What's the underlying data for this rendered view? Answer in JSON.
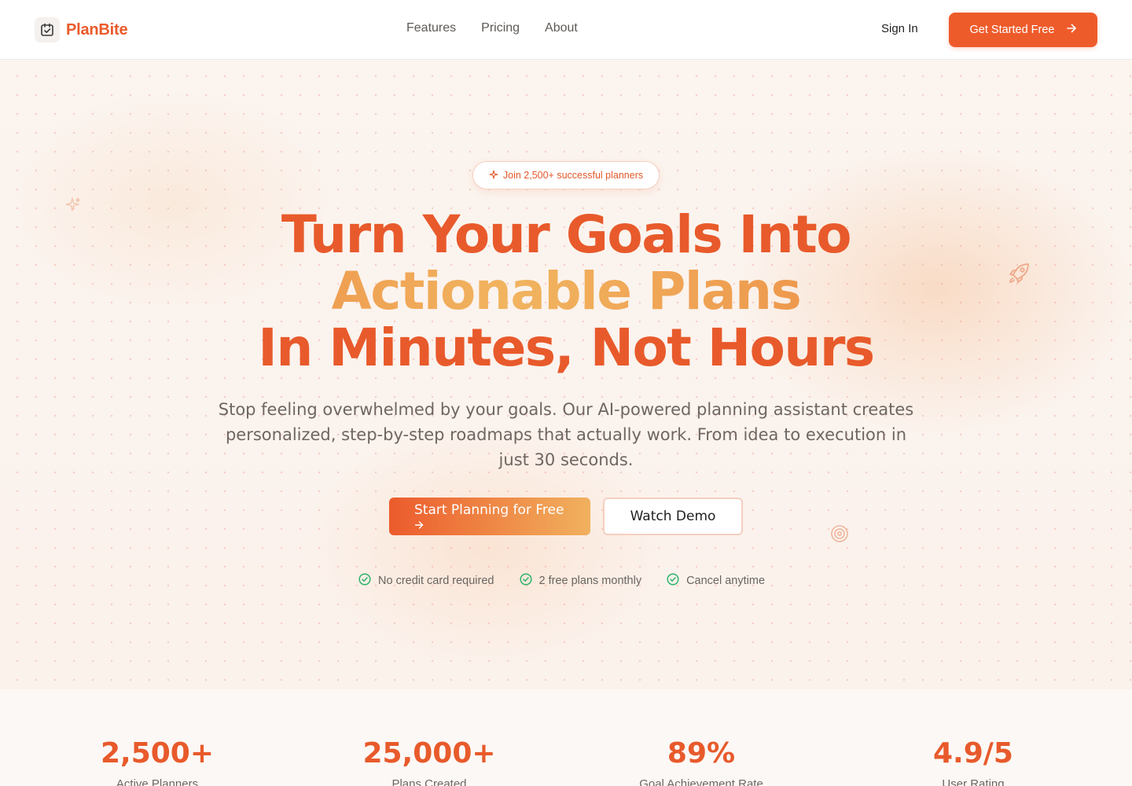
{
  "nav": {
    "brand": "PlanBite",
    "links": [
      "Features",
      "Pricing",
      "About"
    ],
    "signin": "Sign In",
    "cta": "Get Started Free"
  },
  "hero": {
    "badge": "Join 2,500+ successful planners",
    "headline": {
      "line1": "Turn Your Goals Into",
      "line2": "Actionable Plans",
      "line3": "In Minutes, Not Hours"
    },
    "subhead": "Stop feeling overwhelmed by your goals. Our AI-powered planning assistant creates personalized, step-by-step roadmaps that actually work. From idea to execution in just 30 seconds.",
    "primary_cta": "Start Planning for Free",
    "secondary_cta": "Watch Demo",
    "perks": [
      "No credit card required",
      "2 free plans monthly",
      "Cancel anytime"
    ]
  },
  "stats": [
    {
      "value": "2,500+",
      "label": "Active Planners"
    },
    {
      "value": "25,000+",
      "label": "Plans Created"
    },
    {
      "value": "89%",
      "label": "Goal Achievement Rate"
    },
    {
      "value": "4.9/5",
      "label": "User Rating"
    }
  ],
  "colors": {
    "accent": "#ee5b2b",
    "gradient_end": "#f1b15e",
    "success": "#2fb36b"
  },
  "icons": {
    "brand": "calendar-check-icon",
    "cta_arrow": "arrow-right-icon",
    "badge": "sparkle-icon",
    "perk": "check-circle-icon",
    "deco": [
      "sparkles-icon",
      "rocket-icon",
      "target-icon"
    ]
  }
}
